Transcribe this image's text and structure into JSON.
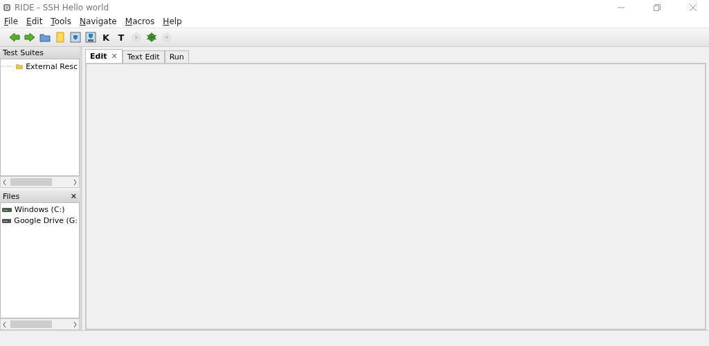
{
  "window": {
    "title": "RIDE - SSH Hello world"
  },
  "menu": [
    "File",
    "Edit",
    "Tools",
    "Navigate",
    "Macros",
    "Help"
  ],
  "toolbar": [
    {
      "kind": "back"
    },
    {
      "kind": "forward"
    },
    {
      "kind": "open"
    },
    {
      "kind": "new"
    },
    {
      "kind": "save"
    },
    {
      "kind": "saveall"
    },
    {
      "kind": "letter",
      "label": "K"
    },
    {
      "kind": "letter",
      "label": "T"
    },
    {
      "kind": "play",
      "disabled": true
    },
    {
      "kind": "bug",
      "disabled": false
    },
    {
      "kind": "stop",
      "disabled": true
    }
  ],
  "test_suites": {
    "title": "Test Suites",
    "items": [
      {
        "label": "External Resc"
      }
    ]
  },
  "files": {
    "title": "Files",
    "close": "✕",
    "items": [
      {
        "label": "Windows (C:)"
      },
      {
        "label": "Google Drive (G:"
      }
    ]
  },
  "tabs": [
    {
      "label": "Edit",
      "selected": true,
      "close": "✕"
    },
    {
      "label": "Text Edit",
      "selected": false
    },
    {
      "label": "Run",
      "selected": false
    }
  ]
}
